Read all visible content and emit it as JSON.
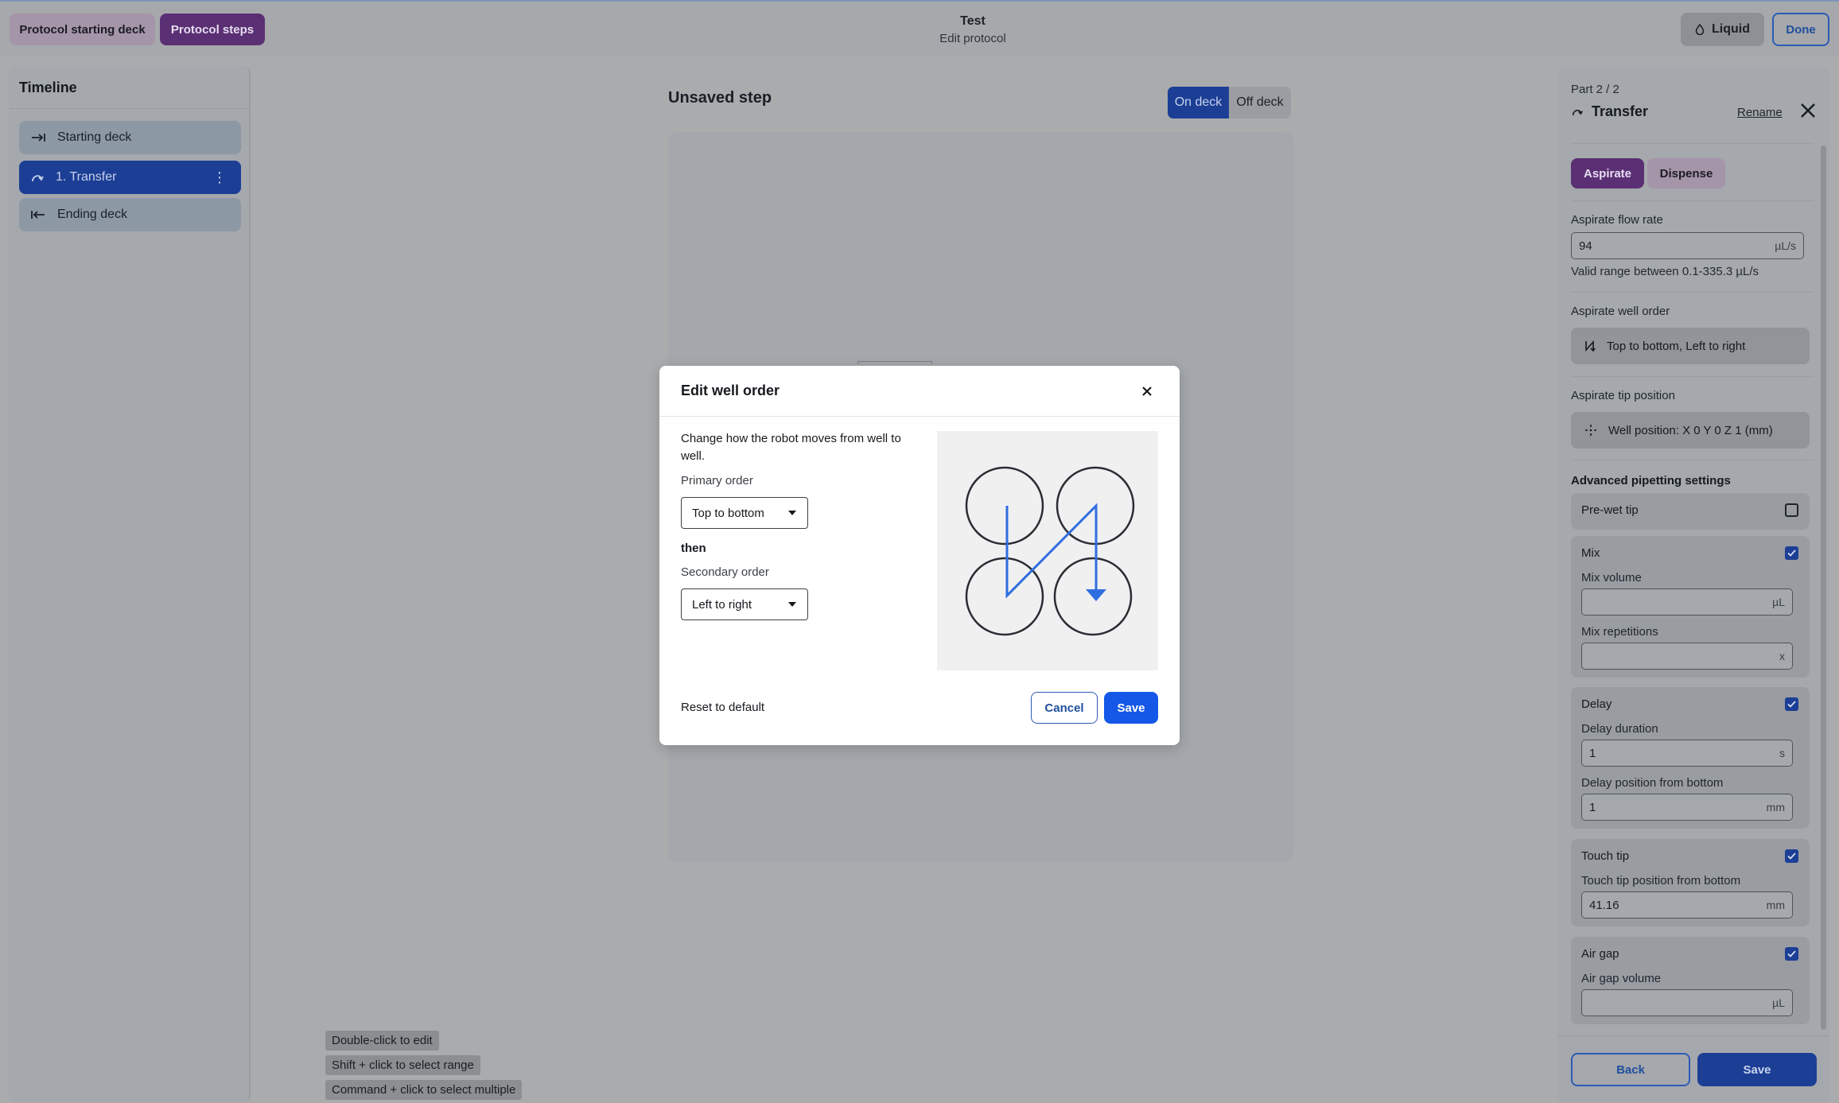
{
  "header": {
    "tab_starting_deck": "Protocol starting deck",
    "tab_steps": "Protocol steps",
    "protocol_name": "Test",
    "subtitle": "Edit protocol",
    "liquid_label": "Liquid",
    "done_label": "Done"
  },
  "timeline": {
    "title": "Timeline",
    "items": [
      {
        "label": "Starting deck",
        "icon": "arrow-right-to-line-icon"
      },
      {
        "label": "1. Transfer",
        "icon": "transfer-curve-icon"
      },
      {
        "label": "Ending deck",
        "icon": "arrow-left-from-line-icon"
      }
    ]
  },
  "canvas": {
    "title": "Unsaved step",
    "on_deck": "On deck",
    "off_deck": "Off deck"
  },
  "hints": [
    "Double-click to edit",
    "Shift + click to select range",
    "Command + click to select multiple"
  ],
  "panel": {
    "part": "Part 2 / 2",
    "title": "Transfer",
    "rename": "Rename",
    "tab_aspirate": "Aspirate",
    "tab_dispense": "Dispense",
    "flow_rate_label": "Aspirate flow rate",
    "flow_rate_value": "94",
    "flow_rate_unit": "µL/s",
    "flow_rate_help": "Valid range between 0.1-335.3 µL/s",
    "well_order_label": "Aspirate well order",
    "well_order_value": "Top to bottom, Left to right",
    "tip_position_label": "Aspirate tip position",
    "tip_position_value": "Well position: X 0 Y 0 Z 1 (mm)",
    "advanced_title": "Advanced pipetting settings",
    "prewet": {
      "label": "Pre-wet tip",
      "checked": false
    },
    "mix": {
      "label": "Mix",
      "checked": true,
      "volume_label": "Mix volume",
      "volume_value": "",
      "volume_unit": "µL",
      "reps_label": "Mix repetitions",
      "reps_value": "",
      "reps_unit": "x"
    },
    "delay": {
      "label": "Delay",
      "checked": true,
      "duration_label": "Delay duration",
      "duration_value": "1",
      "duration_unit": "s",
      "position_label": "Delay position from bottom",
      "position_value": "1",
      "position_unit": "mm"
    },
    "touch_tip": {
      "label": "Touch tip",
      "checked": true,
      "position_label": "Touch tip position from bottom",
      "position_value": "41.16",
      "position_unit": "mm"
    },
    "air_gap": {
      "label": "Air gap",
      "checked": true,
      "volume_label": "Air gap volume",
      "volume_value": "",
      "volume_unit": "µL"
    },
    "back_label": "Back",
    "save_label": "Save"
  },
  "modal": {
    "title": "Edit well order",
    "description": "Change how the robot moves from well to well.",
    "primary_label": "Primary order",
    "primary_value": "Top to bottom",
    "then_label": "then",
    "secondary_label": "Secondary order",
    "secondary_value": "Left to right",
    "reset_label": "Reset to default",
    "cancel_label": "Cancel",
    "save_label": "Save"
  },
  "colors": {
    "accent_blue": "#1558e8",
    "purple": "#5b2f74",
    "path_blue": "#2f6ee0"
  }
}
